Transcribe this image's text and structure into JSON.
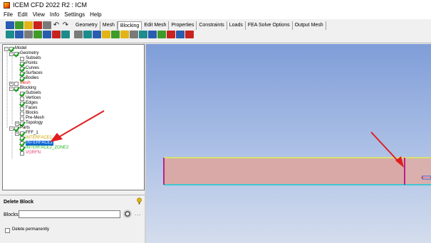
{
  "window": {
    "title": "ICEM CFD 2022 R2 : ICM"
  },
  "menu": [
    "File",
    "Edit",
    "View",
    "Info",
    "Settings",
    "Help"
  ],
  "tabs": [
    "Geometry",
    "Mesh",
    "Blocking",
    "Edit Mesh",
    "Properties",
    "Constraints",
    "Loads",
    "FEA Solve Options",
    "Output Mesh"
  ],
  "active_tab": "Blocking",
  "tree": {
    "model": "Model",
    "geometry": "Geometry",
    "subsets": "Subsets",
    "points": "Points",
    "curves": "Curves",
    "surfaces": "Surfaces",
    "bodies": "Bodies",
    "mesh": "Mesh",
    "blocking": "Blocking",
    "b_subsets": "Subsets",
    "vertices": "Vertices",
    "edges": "Edges",
    "faces": "Faces",
    "blocks": "Blocks",
    "premesh": "Pre-Mesh",
    "topology": "Topology",
    "parts": "Parts",
    "fff": "FFF_1",
    "interface1": "INTERFACE1",
    "interface2": "INTERFACE2",
    "interface2_zone": "INTERFACE2_ZONE2",
    "vorfn": "VORFN"
  },
  "colors": {
    "mesh_label": "#e02020",
    "interface1": "#c9a600",
    "interface2_zone": "#22b322",
    "vorfn": "#e04070",
    "annotation_arrow": "#e01e1e",
    "block_fill": "#d9a9a7",
    "edge_magenta": "#c0208a",
    "edge_yellow": "#d7e070",
    "edge_cyan": "#40c8d0",
    "selected_bg": "#0a64d8"
  },
  "delete_block": {
    "title": "Delete Block",
    "blocks_label": "Blocks",
    "blocks_value": "",
    "dots": "...",
    "delete_perm_label": "Delete permanently",
    "delete_perm_checked": false
  },
  "icons": [
    "save-icon",
    "open-icon",
    "edit-icon",
    "color-icon",
    "undo-icon",
    "redo-icon",
    "measure-icon",
    "fit-icon",
    "zoom-icon",
    "display-icon",
    "select-icon",
    "help-icon"
  ]
}
